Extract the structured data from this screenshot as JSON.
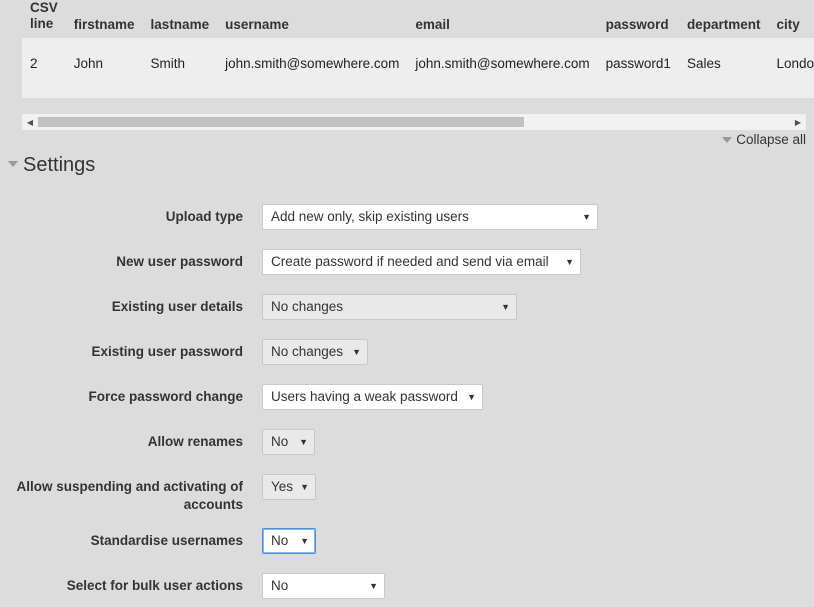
{
  "csv_table": {
    "headers": [
      "CSV line",
      "firstname",
      "lastname",
      "username",
      "email",
      "password",
      "department",
      "city"
    ],
    "rows": [
      [
        "2",
        "John",
        "Smith",
        "john.smith@somewhere.com",
        "john.smith@somewhere.com",
        "password1",
        "Sales",
        "London"
      ]
    ]
  },
  "collapse_all_label": "Collapse all",
  "settings": {
    "title": "Settings",
    "fields": [
      {
        "label": "Upload type",
        "value": "Add new only, skip existing users"
      },
      {
        "label": "New user password",
        "value": "Create password if needed and send via email"
      },
      {
        "label": "Existing user details",
        "value": "No changes"
      },
      {
        "label": "Existing user password",
        "value": "No changes"
      },
      {
        "label": "Force password change",
        "value": "Users having a weak password"
      },
      {
        "label": "Allow renames",
        "value": "No"
      },
      {
        "label": "Allow suspending and activating of accounts",
        "value": "Yes"
      },
      {
        "label": "Standardise usernames",
        "value": "No"
      },
      {
        "label": "Select for bulk user actions",
        "value": "No"
      }
    ]
  },
  "icons": {
    "dropdown": "▼",
    "scroll_left": "◀",
    "scroll_right": "▶"
  }
}
